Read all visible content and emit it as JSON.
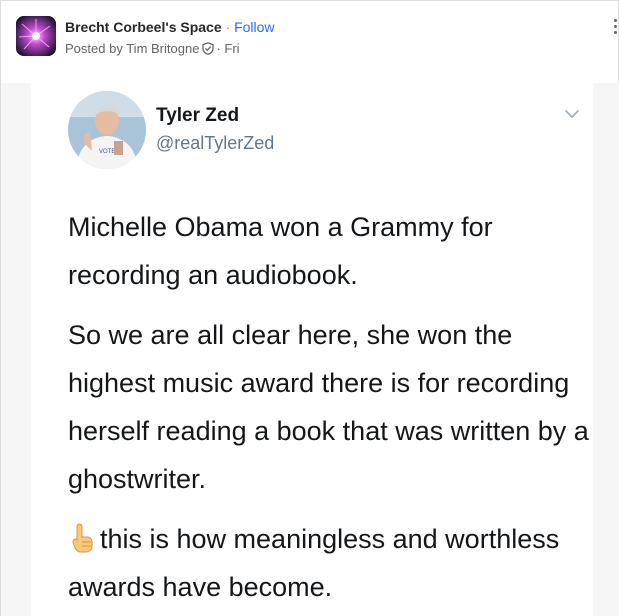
{
  "post_header": {
    "space_name": "Brecht Corbeel's Space",
    "separator": "·",
    "follow_label": "Follow",
    "posted_by_prefix": "Posted by",
    "author": "Tim Britogne",
    "time_separator": "·",
    "posted_time": "Fri",
    "space_avatar_icon": "plasma-ball-image",
    "author_badge_icon": "shield-badge-icon",
    "more_icon": "vertical-ellipsis-icon"
  },
  "tweet": {
    "display_name": "Tyler Zed",
    "handle": "@realTylerZed",
    "avatar_icon": "profile-photo",
    "menu_icon": "chevron-down-icon",
    "paragraph1": "Michelle Obama won a Grammy for recording an audiobook.",
    "paragraph2": "So we are all clear here, she won the highest music award there is for recording herself reading a book that was written by a ghostwriter.",
    "paragraph3_icon": "pointing-down-hand-emoji",
    "paragraph3": "this is how meaningless and worthless awards have become."
  },
  "colors": {
    "follow_link": "#2e69ff",
    "header_text": "#282829",
    "secondary_text": "#636466",
    "tweet_text": "#14171a",
    "tweet_handle": "#657786"
  }
}
